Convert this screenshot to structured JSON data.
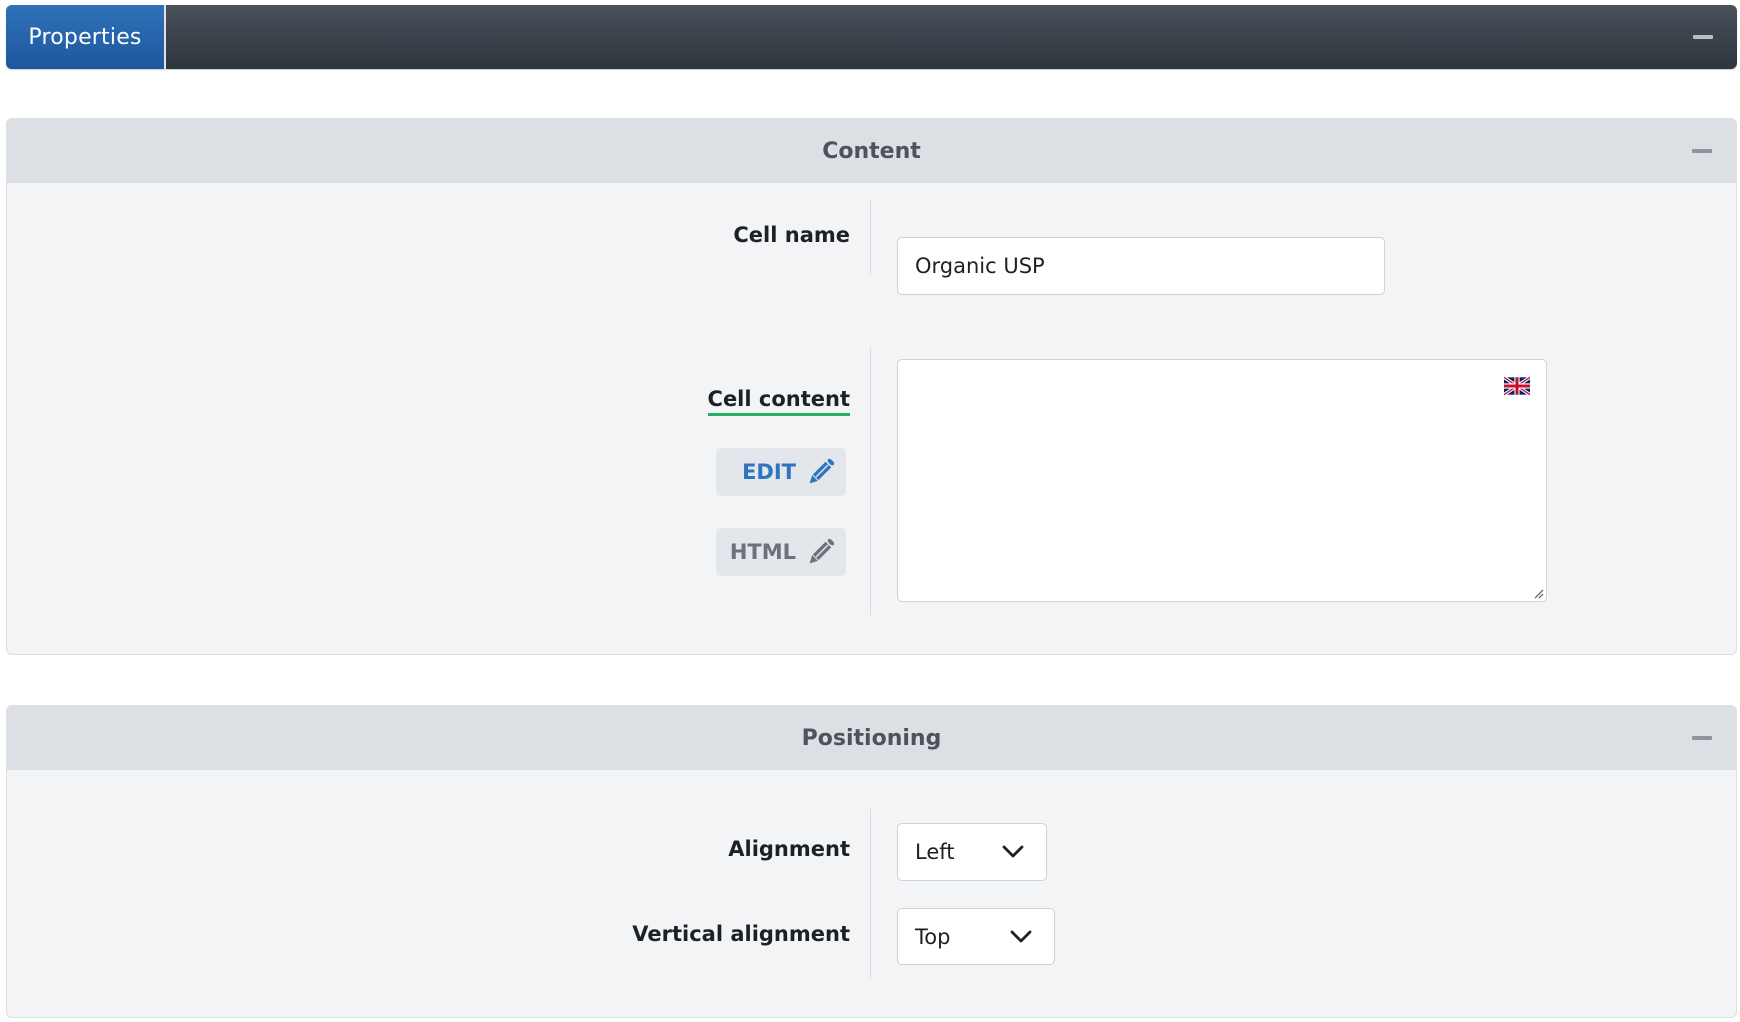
{
  "topbar": {
    "tab_label": "Properties",
    "collapse_icon": "minus-icon"
  },
  "content_section": {
    "title": "Content",
    "collapse_icon": "minus-icon",
    "cell_name": {
      "label": "Cell name",
      "value": "Organic USP"
    },
    "cell_content": {
      "label": "Cell content",
      "value": "",
      "language_flag": "uk-flag-icon",
      "edit_button_label": "EDIT",
      "html_button_label": "HTML",
      "edit_icon": "pencil-icon",
      "html_icon": "pencil-icon"
    }
  },
  "positioning_section": {
    "title": "Positioning",
    "collapse_icon": "minus-icon",
    "alignment": {
      "label": "Alignment",
      "selected": "Left"
    },
    "vertical_alignment": {
      "label": "Vertical alignment",
      "selected": "Top"
    }
  },
  "colors": {
    "accent_blue": "#2e74bf",
    "tab_blue": "#1d57a0",
    "topbar_dark": "#2f353d",
    "active_underline_green": "#27ae60"
  }
}
